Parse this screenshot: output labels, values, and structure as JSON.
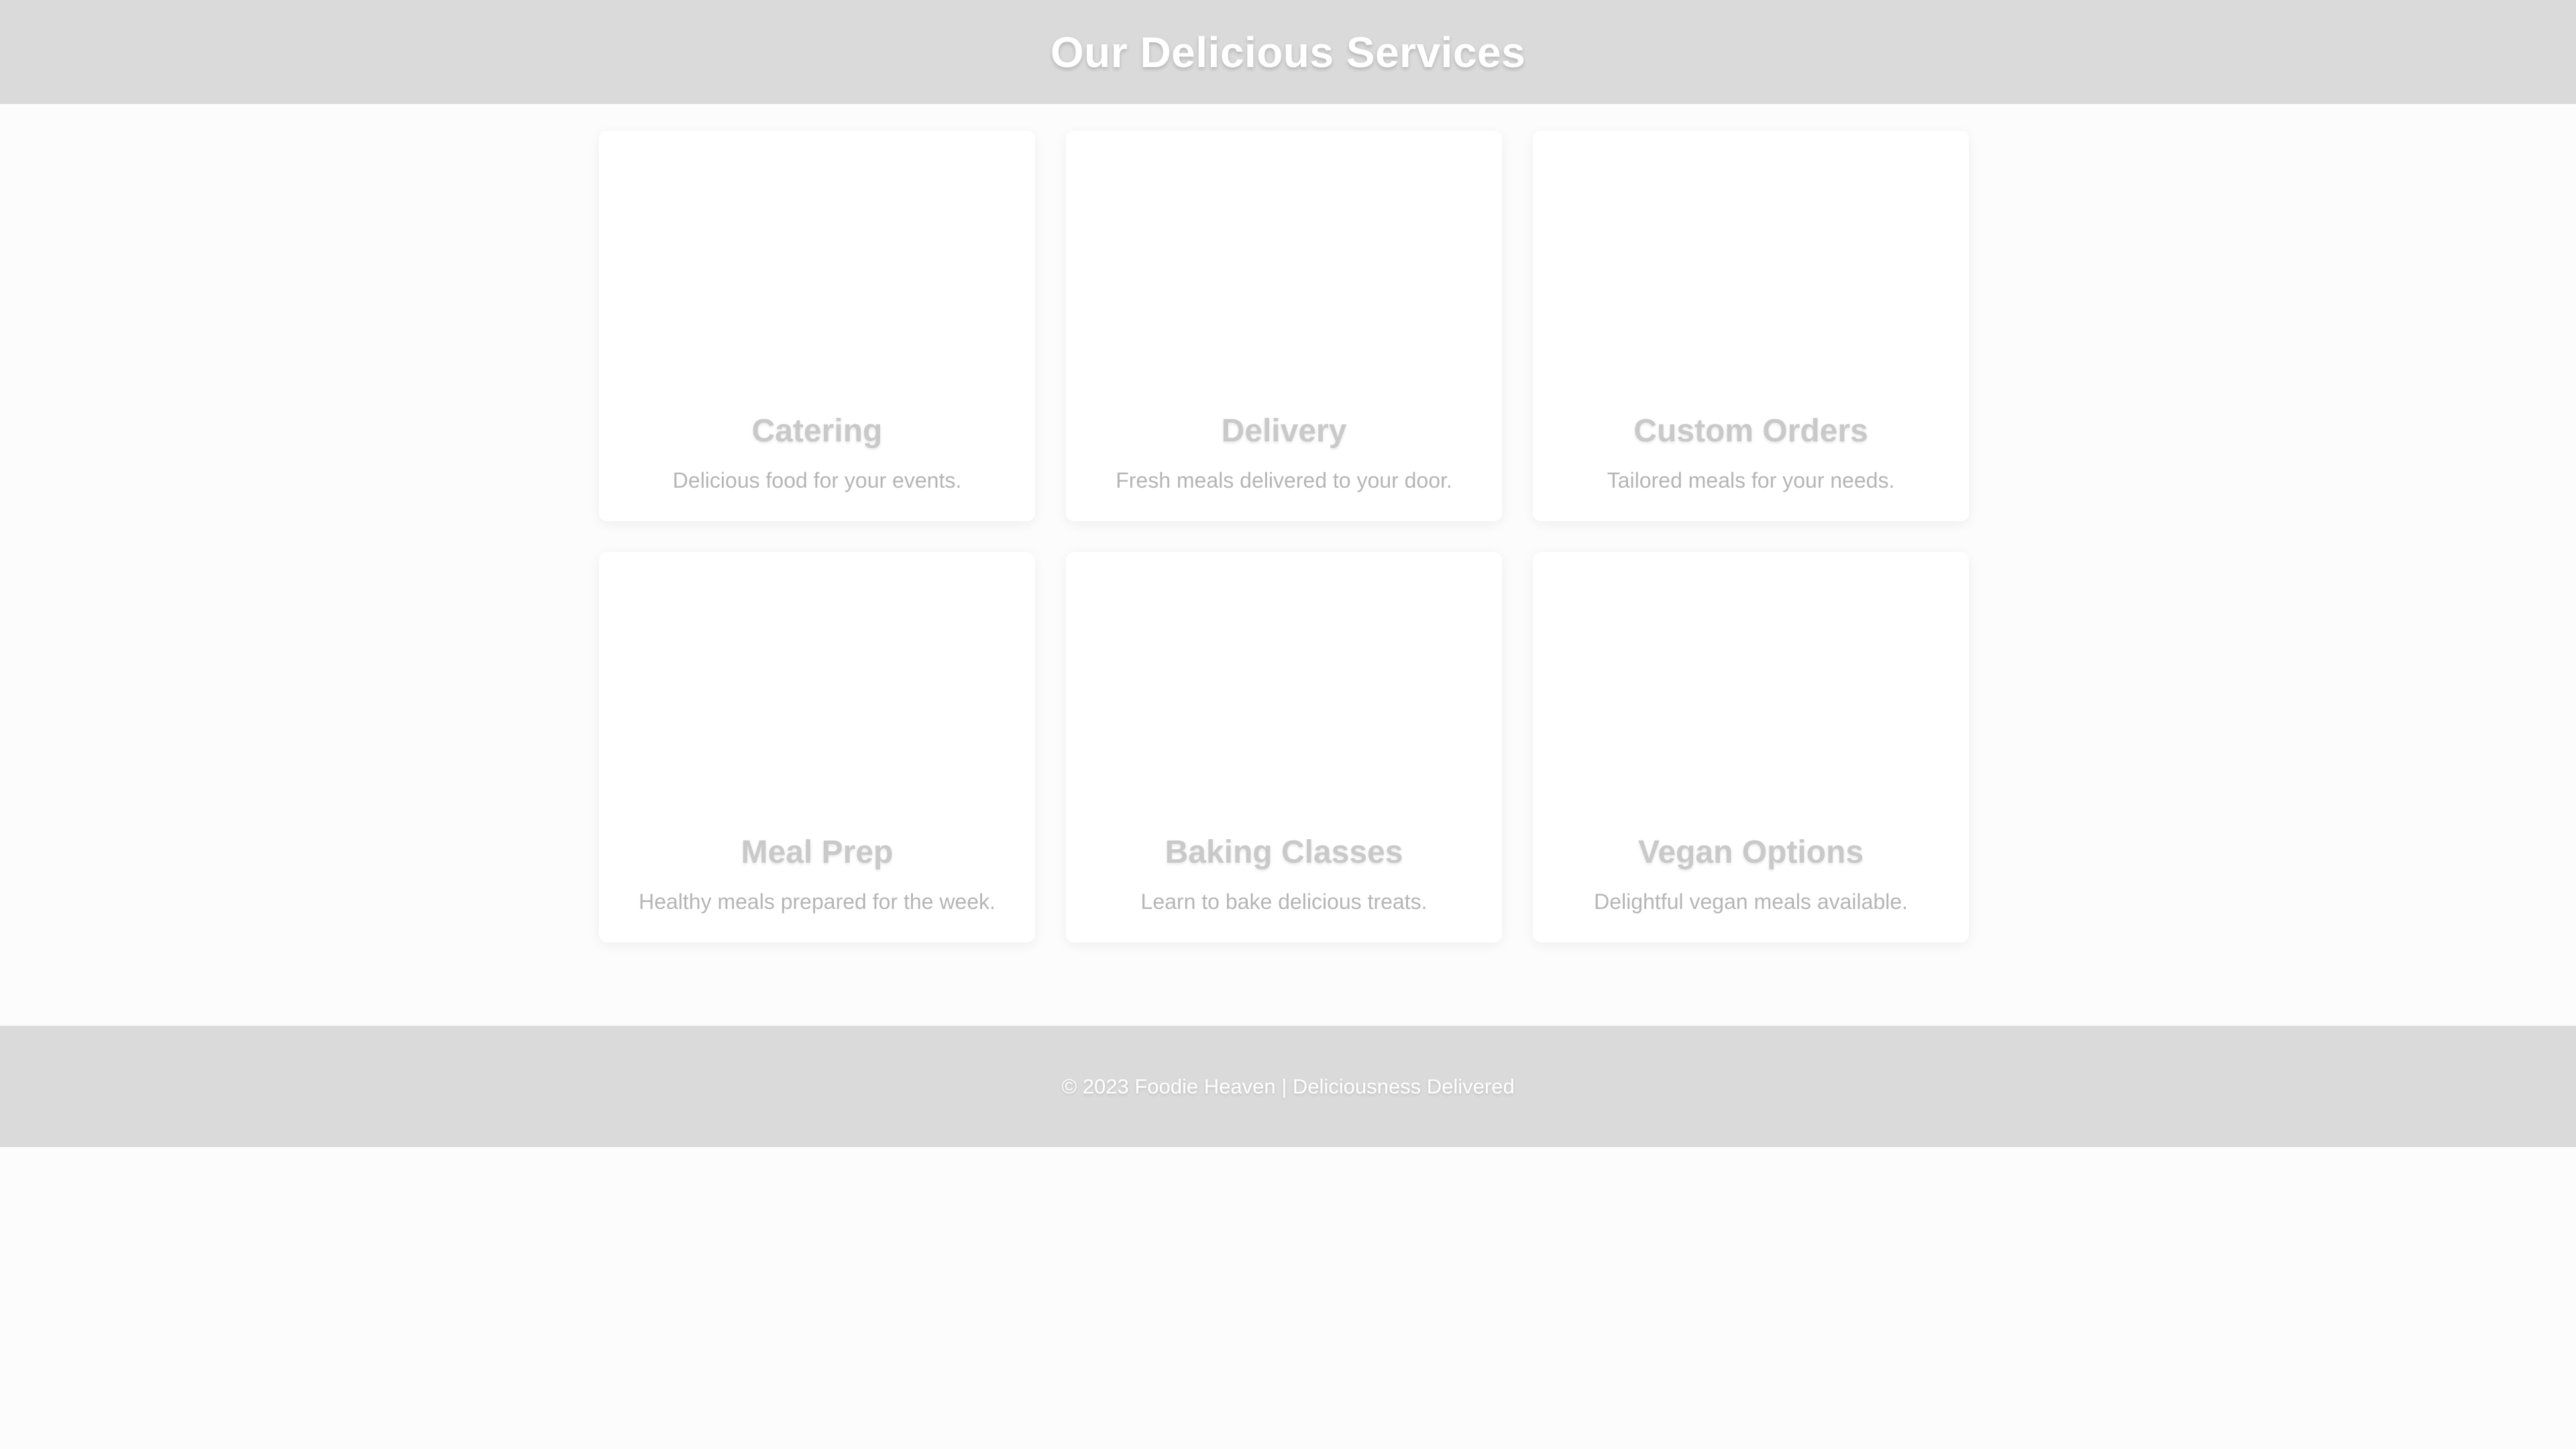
{
  "header": {
    "title": "Our Delicious Services"
  },
  "services": [
    {
      "title": "Catering",
      "description": "Delicious food for your events."
    },
    {
      "title": "Delivery",
      "description": "Fresh meals delivered to your door."
    },
    {
      "title": "Custom Orders",
      "description": "Tailored meals for your needs."
    },
    {
      "title": "Meal Prep",
      "description": "Healthy meals prepared for the week."
    },
    {
      "title": "Baking Classes",
      "description": "Learn to bake delicious treats."
    },
    {
      "title": "Vegan Options",
      "description": "Delightful vegan meals available."
    }
  ],
  "footer": {
    "text": "© 2023 Foodie Heaven | Deliciousness Delivered"
  },
  "colors": {
    "header_bg": "#dadada",
    "footer_bg": "#dadada",
    "card_bg": "#ffffff",
    "page_bg": "#fcfcfc"
  }
}
